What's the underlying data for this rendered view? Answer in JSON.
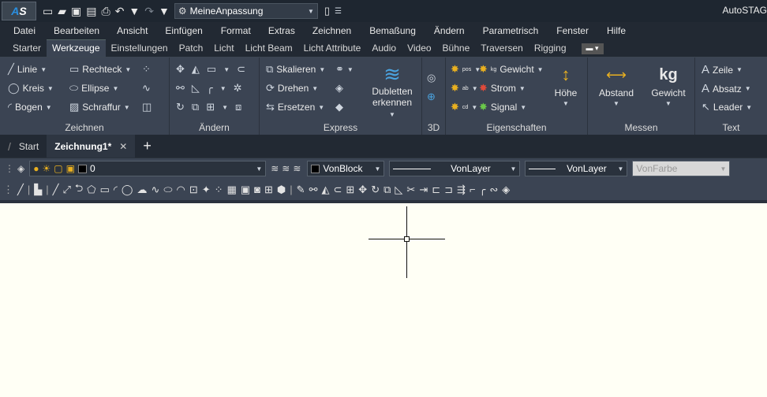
{
  "app": {
    "logo_text": "AS",
    "title": "AutoSTAG"
  },
  "workspace": {
    "value": "MeineAnpassung"
  },
  "menu": [
    "Datei",
    "Bearbeiten",
    "Ansicht",
    "Einfügen",
    "Format",
    "Extras",
    "Zeichnen",
    "Bemaßung",
    "Ändern",
    "Parametrisch",
    "Fenster",
    "Hilfe"
  ],
  "ribbon_tabs": [
    "Starter",
    "Werkzeuge",
    "Einstellungen",
    "Patch",
    "Licht",
    "Licht Beam",
    "Licht Attribute",
    "Audio",
    "Video",
    "Bühne",
    "Traversen",
    "Rigging"
  ],
  "active_tab": "Werkzeuge",
  "panels": {
    "zeichnen": {
      "title": "Zeichnen",
      "items": [
        "Linie",
        "Rechteck",
        "Kreis",
        "Ellipse",
        "Bogen",
        "Schraffur"
      ]
    },
    "aendern": {
      "title": "Ändern"
    },
    "express": {
      "title": "Express",
      "items": [
        "Skalieren",
        "Drehen",
        "Ersetzen",
        "Dubletten",
        "erkennen"
      ]
    },
    "threed": {
      "title": "3D"
    },
    "eigenschaften": {
      "title": "Eigenschaften",
      "items": [
        "Gewicht",
        "Strom",
        "Signal",
        "Höhe"
      ],
      "icon_labels": [
        "pos",
        "kg",
        "ab",
        "cd"
      ]
    },
    "messen": {
      "title": "Messen",
      "items": [
        "Abstand",
        "Gewicht"
      ],
      "icon_label": "kg"
    },
    "text": {
      "title": "Text",
      "items": [
        "Zeile",
        "Absatz",
        "Leader"
      ]
    }
  },
  "doc_tabs": {
    "start": "Start",
    "active": "Zeichnung1*"
  },
  "layer": {
    "value": "0",
    "color_value": "VonBlock",
    "linetype": "VonLayer",
    "lineweight": "VonLayer",
    "plotstyle": "VonFarbe"
  },
  "colors": {
    "accent": "#2a8fe0",
    "ribbon_bg": "#3b4453",
    "canvas_bg": "#fffff5"
  }
}
